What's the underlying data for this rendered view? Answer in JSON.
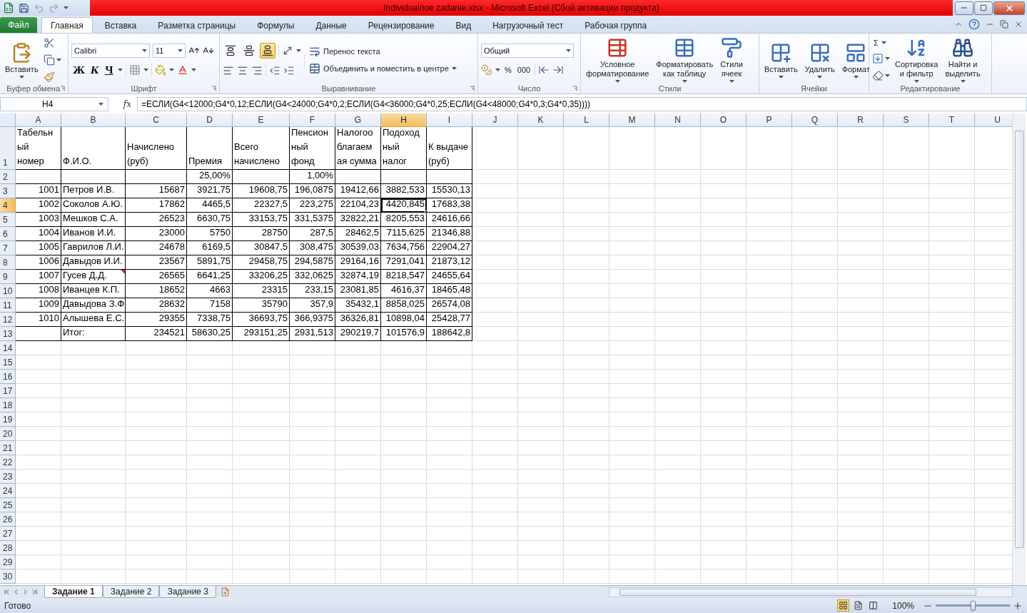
{
  "window": {
    "title": "Individualnoe zadanie.xlsx  -  Microsoft Excel (Сбой активации продукта)"
  },
  "file_tab": "Файл",
  "tabs": [
    {
      "label": "Главная",
      "selected": true
    },
    {
      "label": "Вставка",
      "selected": false
    },
    {
      "label": "Разметка страницы",
      "selected": false
    },
    {
      "label": "Формулы",
      "selected": false
    },
    {
      "label": "Данные",
      "selected": false
    },
    {
      "label": "Рецензирование",
      "selected": false
    },
    {
      "label": "Вид",
      "selected": false
    },
    {
      "label": "Нагрузочный тест",
      "selected": false
    },
    {
      "label": "Рабочая группа",
      "selected": false
    }
  ],
  "ribbon": {
    "groups": [
      {
        "kind": "clipboard",
        "label": "Буфер обмена",
        "launcher": true,
        "paste": "Вставить"
      },
      {
        "kind": "font",
        "label": "Шрифт",
        "launcher": true,
        "font": "Calibri",
        "size": "11",
        "bold": "Ж",
        "italic": "К",
        "underline": "Ч"
      },
      {
        "kind": "alignment",
        "label": "Выравнивание",
        "launcher": true,
        "vertical_align": [
          {
            "selected": false
          },
          {
            "selected": false
          },
          {
            "selected": true
          }
        ],
        "wrap": "Перенос текста",
        "merge": "Объединить и поместить в центре"
      },
      {
        "kind": "number",
        "label": "Число",
        "launcher": true,
        "format": "Общий",
        "percent": "%",
        "thousands": "000"
      },
      {
        "kind": "styles",
        "label": "Стили",
        "launcher": false,
        "buttons": [
          "Условное\nформатирование",
          "Форматировать\nкак таблицу",
          "Стили\nячеек"
        ]
      },
      {
        "kind": "cells",
        "label": "Ячейки",
        "launcher": false,
        "buttons": [
          "Вставить",
          "Удалить",
          "Формат"
        ]
      },
      {
        "kind": "editing",
        "label": "Редактирование",
        "launcher": false,
        "sum": "Σ",
        "buttons": [
          "Сортировка\nи фильтр",
          "Найти и\nвыделить"
        ]
      }
    ]
  },
  "formula_bar": {
    "name_box": "H4",
    "fx": "fx",
    "formula": "=ЕСЛИ(G4<12000;G4*0,12;ЕСЛИ(G4<24000;G4*0,2;ЕСЛИ(G4<36000;G4*0,25;ЕСЛИ(G4<48000;G4*0,3;G4*0,35))))"
  },
  "columns": [
    {
      "label": "A",
      "kind": "number",
      "selected": false
    },
    {
      "label": "B",
      "kind": "text",
      "selected": false
    },
    {
      "label": "C",
      "kind": "number",
      "selected": false
    },
    {
      "label": "D",
      "kind": "number",
      "selected": false
    },
    {
      "label": "E",
      "kind": "number",
      "selected": false
    },
    {
      "label": "F",
      "kind": "number",
      "selected": false
    },
    {
      "label": "G",
      "kind": "number",
      "selected": false
    },
    {
      "label": "H",
      "kind": "number",
      "selected": true
    },
    {
      "label": "I",
      "kind": "number",
      "selected": false
    },
    {
      "label": "J",
      "kind": "number",
      "selected": false
    },
    {
      "label": "K",
      "kind": "number",
      "selected": false
    },
    {
      "label": "L",
      "kind": "number",
      "selected": false
    },
    {
      "label": "M",
      "kind": "number",
      "selected": false
    },
    {
      "label": "N",
      "kind": "number",
      "selected": false
    },
    {
      "label": "O",
      "kind": "number",
      "selected": false
    },
    {
      "label": "P",
      "kind": "number",
      "selected": false
    },
    {
      "label": "Q",
      "kind": "number",
      "selected": false
    },
    {
      "label": "R",
      "kind": "number",
      "selected": false
    },
    {
      "label": "S",
      "kind": "number",
      "selected": false
    },
    {
      "label": "T",
      "kind": "number",
      "selected": false
    },
    {
      "label": "U",
      "kind": "number",
      "selected": false
    }
  ],
  "rows": [
    {
      "number": "1",
      "kind": "header",
      "selected": false,
      "cells": [
        "Табельн\nый\nномер",
        "Ф.И.О.",
        "Начислено\n(руб)",
        "Премия",
        "Всего\nначислено",
        "Пенсион\nный\nфонд",
        "Налогоо\nблагаем\nая сумма",
        "Подоход\nный\nналог",
        "К выдаче\n(руб)"
      ]
    },
    {
      "number": "2",
      "kind": "data",
      "selected": false,
      "cells": [
        null,
        null,
        null,
        "25,00%",
        null,
        "1,00%",
        null,
        null,
        null
      ]
    },
    {
      "number": "3",
      "kind": "data",
      "selected": false,
      "cells": [
        "1001",
        "Петров И.В.",
        "15687",
        "3921,75",
        "19608,75",
        "196,0875",
        "19412,66",
        "3882,533",
        "15530,13"
      ]
    },
    {
      "number": "4",
      "kind": "data",
      "selected": true,
      "cells": [
        "1002",
        "Соколов А.Ю.",
        "17862",
        "4465,5",
        "22327,5",
        "223,275",
        "22104,23",
        "4420,845",
        "17683,38"
      ]
    },
    {
      "number": "5",
      "kind": "data",
      "selected": false,
      "cells": [
        "1003",
        "Мешков С.А.",
        "26523",
        "6630,75",
        "33153,75",
        "331,5375",
        "32822,21",
        "8205,553",
        "24616,66"
      ]
    },
    {
      "number": "6",
      "kind": "data",
      "selected": false,
      "cells": [
        "1004",
        "Иванов И.И.",
        "23000",
        "5750",
        "28750",
        "287,5",
        "28462,5",
        "7115,625",
        "21346,88"
      ]
    },
    {
      "number": "7",
      "kind": "data",
      "selected": false,
      "cells": [
        "1005",
        "Гаврилов Л.И.",
        "24678",
        "6169,5",
        "30847,5",
        "308,475",
        "30539,03",
        "7634,756",
        "22904,27"
      ]
    },
    {
      "number": "8",
      "kind": "data",
      "selected": false,
      "cells": [
        "1006",
        "Давыдов И.И.",
        "23567",
        "5891,75",
        "29458,75",
        "294,5875",
        "29164,16",
        "7291,041",
        "21873,12"
      ]
    },
    {
      "number": "9",
      "kind": "data",
      "selected": false,
      "cells": [
        "1007",
        {
          "text": "Гусев Д.Д.",
          "comment": true
        },
        "26565",
        "6641,25",
        "33206,25",
        "332,0625",
        "32874,19",
        "8218,547",
        "24655,64"
      ]
    },
    {
      "number": "10",
      "kind": "data",
      "selected": false,
      "cells": [
        "1008",
        "Иванцев К.П.",
        "18652",
        "4663",
        "23315",
        "233,15",
        "23081,85",
        "4616,37",
        "18465,48"
      ]
    },
    {
      "number": "11",
      "kind": "data",
      "selected": false,
      "cells": [
        "1009",
        "Давыдова З.Ф",
        "28632",
        "7158",
        "35790",
        "357,9",
        "35432,1",
        "8858,025",
        "26574,08"
      ]
    },
    {
      "number": "12",
      "kind": "data",
      "selected": false,
      "cells": [
        "1010",
        "Алышева Е.С.",
        "29355",
        "7338,75",
        "36693,75",
        "366,9375",
        "36326,81",
        "10898,04",
        "25428,77"
      ]
    },
    {
      "number": "13",
      "kind": "data",
      "selected": false,
      "cells": [
        null,
        "Итог:",
        "234521",
        "58630,25",
        "293151,25",
        "2931,513",
        "290219,7",
        "101576,9",
        "188642,8"
      ]
    },
    {
      "number": "14",
      "selected": false
    },
    {
      "number": "15",
      "selected": false
    },
    {
      "number": "16",
      "selected": false
    },
    {
      "number": "17",
      "selected": false
    },
    {
      "number": "18",
      "selected": false
    },
    {
      "number": "19",
      "selected": false
    },
    {
      "number": "20",
      "selected": false
    },
    {
      "number": "21",
      "selected": false
    },
    {
      "number": "22",
      "selected": false
    },
    {
      "number": "23",
      "selected": false
    },
    {
      "number": "24",
      "selected": false
    },
    {
      "number": "25",
      "selected": false
    },
    {
      "number": "26",
      "selected": false
    },
    {
      "number": "27",
      "selected": false
    },
    {
      "number": "28",
      "selected": false
    },
    {
      "number": "29",
      "selected": false
    },
    {
      "number": "30",
      "selected": false
    }
  ],
  "sheets": [
    {
      "label": "Задание 1",
      "selected": true
    },
    {
      "label": "Задание 2",
      "selected": false
    },
    {
      "label": "Задание 3",
      "selected": false
    }
  ],
  "status_bar": {
    "status": "Готово",
    "views": [
      {
        "selected": true
      },
      {
        "selected": false
      },
      {
        "selected": false
      }
    ],
    "zoom": "100%",
    "zoom_slider": {
      "level": 0.5
    }
  }
}
